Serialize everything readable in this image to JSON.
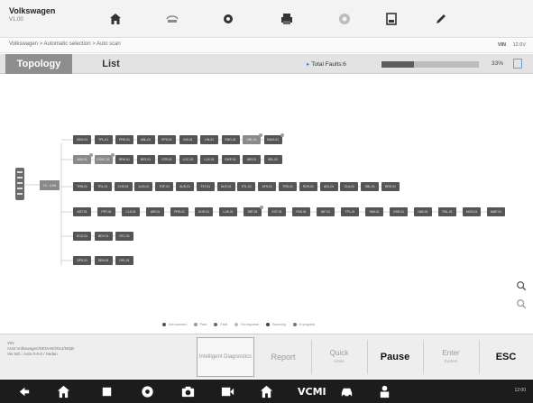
{
  "header": {
    "brand": "Volkswagen",
    "brand_sub": "V1.00",
    "tools": [
      {
        "name": "home-icon"
      },
      {
        "name": "vehicle-swap-icon"
      },
      {
        "name": "settings-icon"
      },
      {
        "name": "print-icon"
      },
      {
        "name": "help-icon"
      },
      {
        "name": "save-icon"
      },
      {
        "name": "data-logging-icon"
      }
    ]
  },
  "breadcrumb": {
    "path": "Volkswagen > Automatic selection > Auto scan",
    "vin": "VIN",
    "battery": "12.0V"
  },
  "tabs": {
    "topology": "Topology",
    "list": "List"
  },
  "status": {
    "total_faults": "Total Faults:6",
    "progress_percent": 33,
    "percent_label": "33%"
  },
  "topology": {
    "gateway": "19 - CAN",
    "row1": [
      "0001-01",
      "TPL-01",
      "PRE-01",
      "ABL-01",
      "EPS-01",
      "INS-01",
      "LIN-01",
      "ENG-01",
      "OBL-01",
      "DIAG-01"
    ],
    "row2": [
      "ABS-01",
      "EGBC-01",
      "BRK-01",
      "BST-01",
      "STR-01",
      "LOC-01",
      "LUX-01",
      "EWP-01",
      "AIR-01",
      "SEL-01"
    ],
    "row3": [
      "TRN-01",
      "TRL-01",
      "CHS-01",
      "LUG-01",
      "TOP-01",
      "AUD-01",
      "PLT-01",
      "DLR-01",
      "ETL-01",
      "AFS-01",
      "TRD-01",
      "RDR-01",
      "ADL-01",
      "CLA-01",
      "SBL-01",
      "BRS-01"
    ],
    "row4": [
      "ADT-01",
      "PRT-01",
      "CLS-01",
      "AIR-01",
      "PRS-01",
      "DOR-01",
      "LUK-01",
      "SBT-01",
      "EXT-01",
      "PAS-01",
      "INF-01",
      "TPL-01",
      "HMI-01",
      "GSR-01",
      "NAV-01",
      "RSL-01",
      "MOS-01",
      "MAP-01"
    ],
    "row5": [
      "ECO-01",
      "BDY-01",
      "STC-01"
    ],
    "row6": [
      "OPS-01",
      "SEN-01",
      "DPL-01"
    ]
  },
  "legend": [
    "Not scanned",
    "Pass",
    "Fault",
    "No response",
    "Scanning",
    "In progress"
  ],
  "info": {
    "line1": "VIN",
    "line2": "Auto:Volkswagen/SEDAN/2014/MQB",
    "line3": "Ver.NO.: Auto 0-0-0 / Sedan"
  },
  "actions": {
    "intelligent": "Intelligent Diagnostics",
    "report": "Report",
    "quick_erase": "Quick",
    "quick_sub": "erase",
    "pause": "Pause",
    "enter": "Enter",
    "enter_sub": "System",
    "esc": "ESC"
  },
  "navbar": {
    "vci": "VCMI",
    "clock": "12:00"
  },
  "colors": {
    "ecu_dark": "#555555",
    "ecu_light": "#8a8a8a",
    "tab_active": "#8e8e8e",
    "accent": "#3a7bd5"
  }
}
